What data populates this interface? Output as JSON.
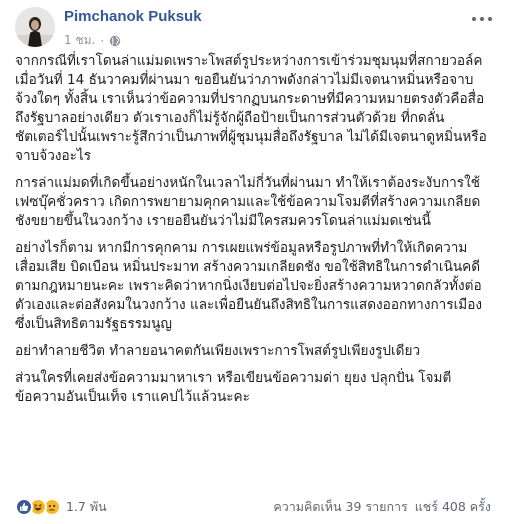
{
  "post": {
    "author": "Pimchanok Puksuk",
    "time": "1 ชม.",
    "separator": "·",
    "privacy_icon": "globe-icon",
    "paragraphs": [
      "จากกรณีที่เราโดนล่าแม่มดเพราะโพสต์รูประหว่างการเข้าร่วมชุมนุมที่สกายวอล์ค เมื่อวันที่ 14 ธันวาคมที่ผ่านมา ขอยืนยันว่าภาพดังกล่าวไม่มีเจตนาหมิ่นหรือจาบจ้วงใดๆ ทั้งสิ้น เราเห็นว่าข้อความที่ปรากฏบนกระดาษที่มีความหมายตรงตัวคือสื่อถึงรัฐบาลอย่างเดียว ตัวเราเองก็ไม่รู้จักผู้ถือป้ายเป็นการส่วนตัวด้วย ที่กดลั่นชัตเตอร์ไปนั้นเพราะรู้สึกว่าเป็นภาพที่ผู้ชุมนุมสื่อถึงรัฐบาล ไม่ได้มีเจตนาดูหมิ่นหรือจาบจ้วงอะไร",
      "การล่าแม่มดที่เกิดขึ้นอย่างหนักในเวลาไม่กี่วันที่ผ่านมา ทำให้เราต้องระงับการใช้เฟซบุ๊คชั่วคราว เกิดการพยายามคุกคามและใช้ข้อความโจมตีที่สร้างความเกลียดชังขยายขึ้นในวงกว้าง เรายอยืนยันว่าไม่มีใครสมควรโดนล่าแม่มดเช่นนี้",
      "อย่างไรก็ตาม หากมีการคุกคาม การเผยแพร่ข้อมูลหรือรูปภาพที่ทำให้เกิดความเสื่อมเสีย บิดเบือน หมิ่นประมาท สร้างความเกลียดชัง ขอใช้สิทธิในการดำเนินคดีตามกฎหมายนะคะ เพราะคิดว่าหากนิ่งเงียบต่อไปจะยิ่งสร้างความหวาดกลัวทั้งต่อตัวเองและต่อสังคมในวงกว้าง และเพื่อยืนยันถึงสิทธิในการแสดงออกทางการเมือง ซึ่งเป็นสิทธิตามรัฐธรรมนูญ",
      "อย่าทำลายชีวิต ทำลายอนาคตกันเพียงเพราะการโพสต์รูปเพียงรูปเดียว",
      "ส่วนใครที่เคยส่งข้อความมาหาเรา หรือเขียนข้อความด่า ยุยง ปลุกปั่น โจมตีข้อความอันเป็นเท็จ เราแคปไว้แล้วนะคะ"
    ],
    "reactions": {
      "icons": [
        "like-icon",
        "haha-icon",
        "sad-icon"
      ],
      "count": "1.7 พัน"
    },
    "comments": "ความคิดเห็น 39 รายการ",
    "shares": "แชร์ 408 ครั้ง"
  },
  "colors": {
    "author": "#365899",
    "like": "#3b5998",
    "emoji": "#f7b928",
    "meta": "#90949c"
  }
}
